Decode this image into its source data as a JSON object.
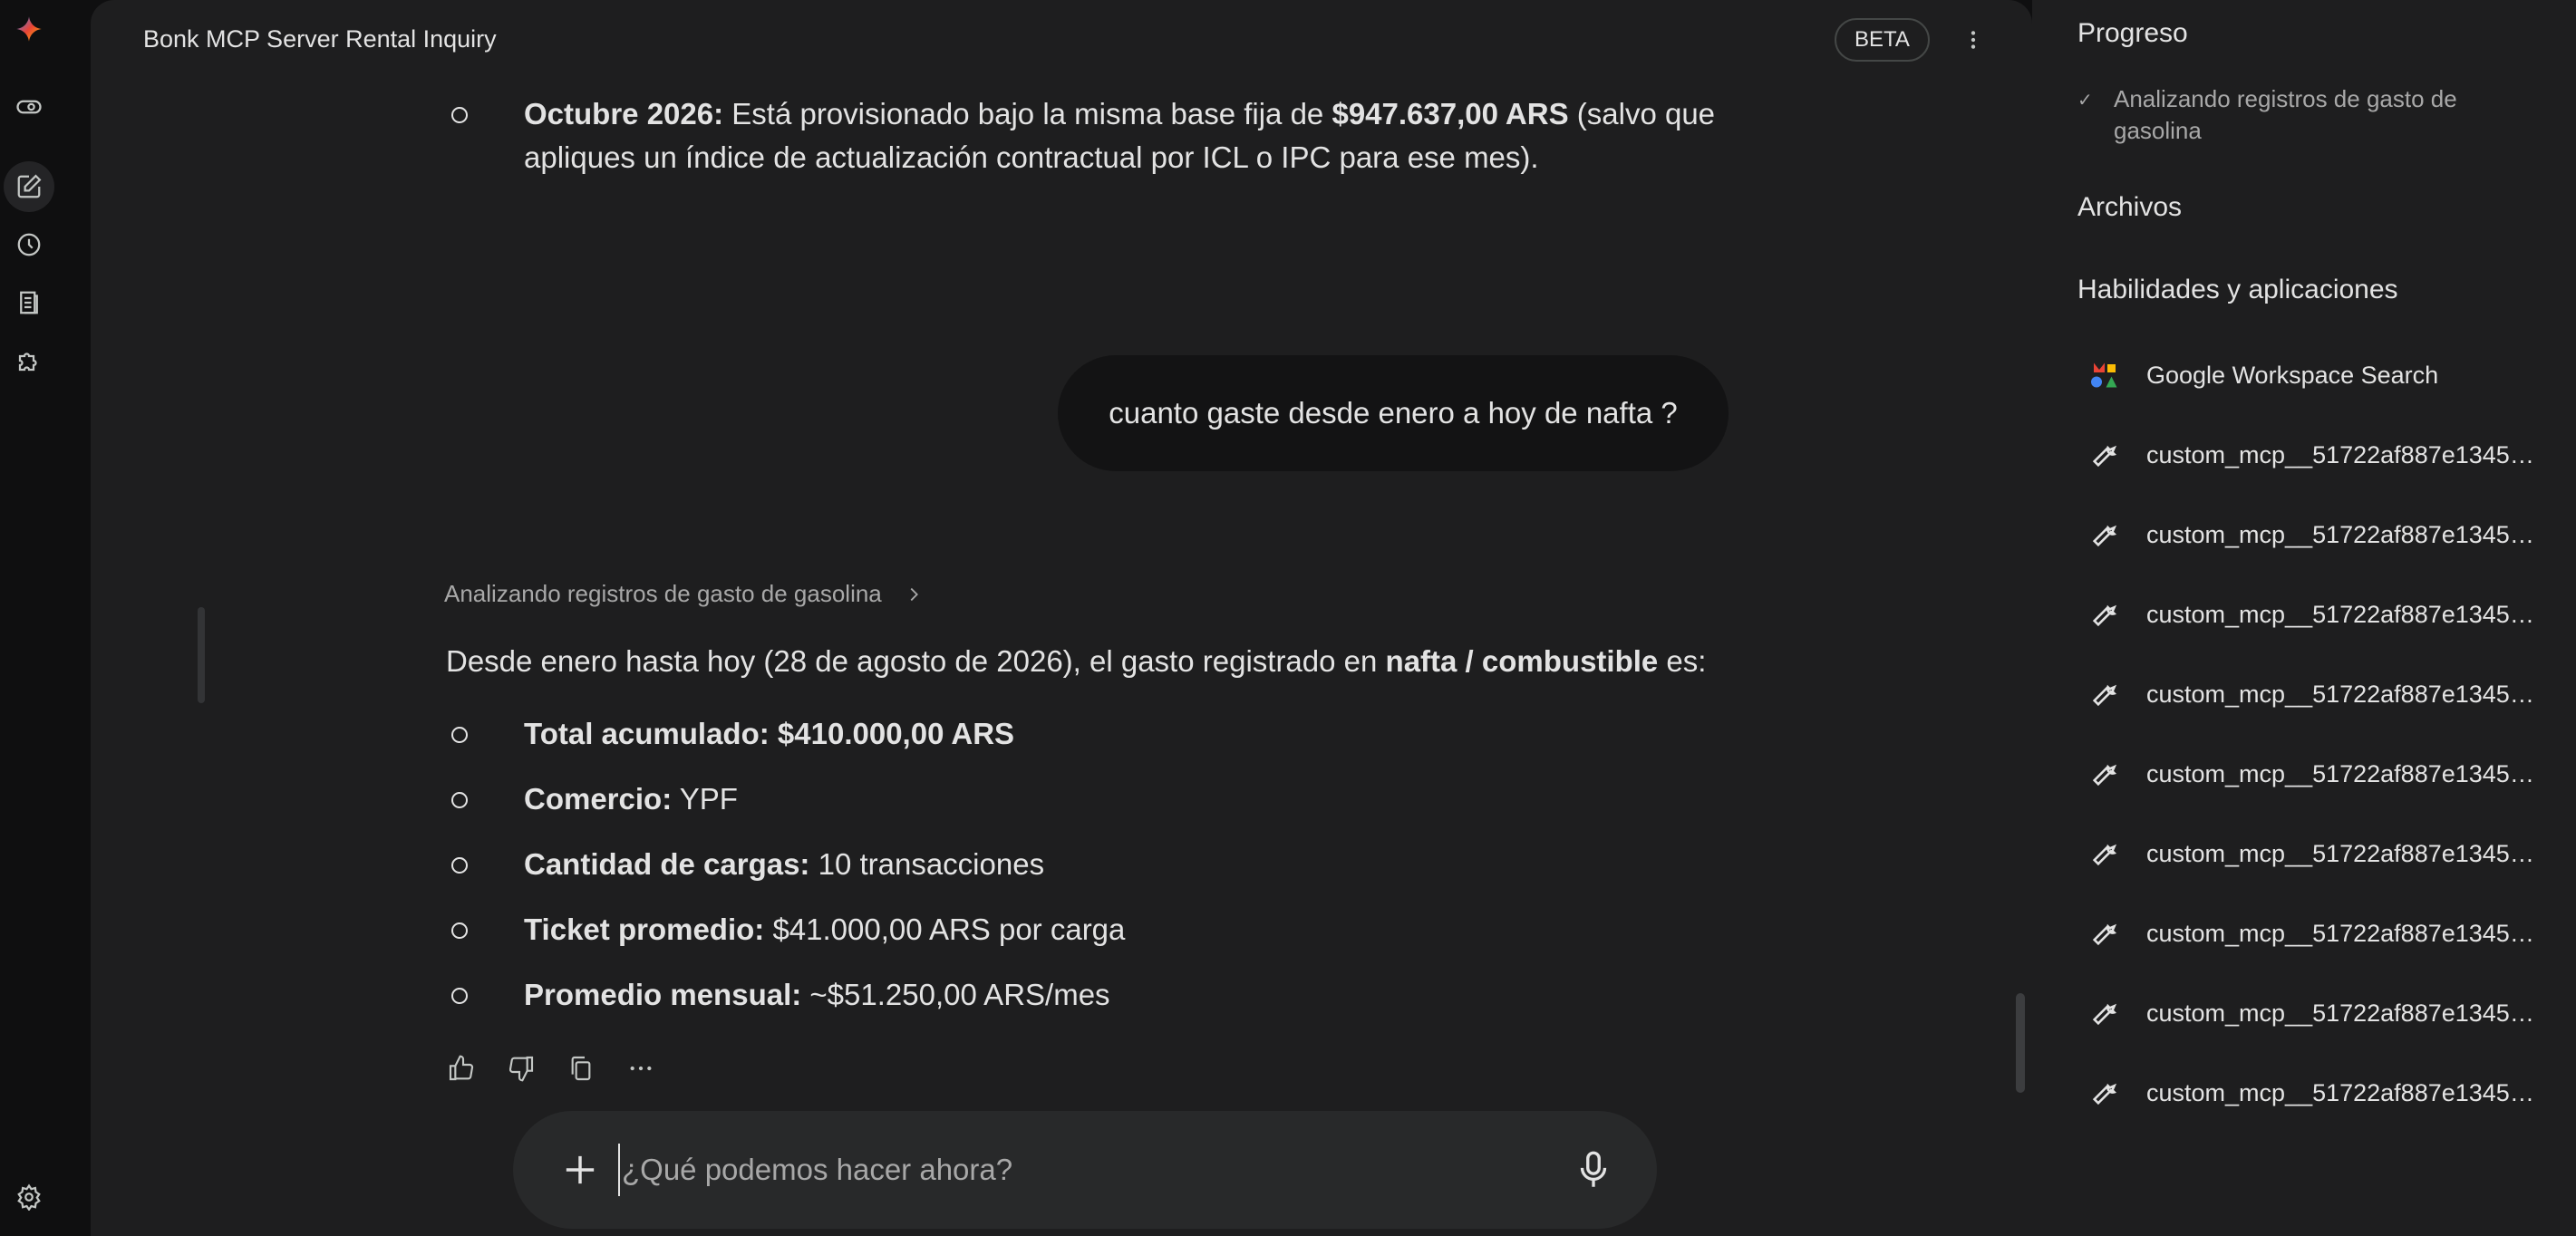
{
  "header": {
    "title": "Bonk MCP Server Rental Inquiry",
    "badge": "BETA"
  },
  "chat": {
    "prev_item": {
      "label": "Octubre 2026:",
      "text_a": " Está provisionado bajo la misma base fija de ",
      "amount": "$947.637,00 ARS",
      "text_b": " (salvo que",
      "line2": "apliques un índice de actualización contractual por ICL o IPC para ese mes)."
    },
    "user_message": "cuanto gaste desde enero a hoy de nafta ?",
    "thinking_label": "Analizando registros de gasto de gasolina",
    "intro": {
      "a": "Desde enero hasta hoy (28 de agosto de 2026), el gasto registrado en ",
      "b": "nafta / combustible",
      "c": " es:"
    },
    "items": [
      {
        "label": "Total acumulado:",
        "value": " $410.000,00 ARS"
      },
      {
        "label": "Comercio:",
        "value": " YPF"
      },
      {
        "label": "Cantidad de cargas:",
        "value": " 10 transacciones"
      },
      {
        "label": "Ticket promedio:",
        "value": " $41.000,00 ARS por carga"
      },
      {
        "label": "Promedio mensual:",
        "value": " ~$51.250,00 ARS/mes"
      }
    ]
  },
  "composer": {
    "placeholder": "¿Qué podemos hacer ahora?"
  },
  "side": {
    "progress_title": "Progreso",
    "progress_item": "Analizando registros de gasto de gasolina",
    "files_title": "Archivos",
    "skills_title": "Habilidades y aplicaciones",
    "apps": [
      "Google Workspace Search",
      "custom_mcp__51722af887e1345c0...",
      "custom_mcp__51722af887e1345c0...",
      "custom_mcp__51722af887e1345c0...",
      "custom_mcp__51722af887e1345c0...",
      "custom_mcp__51722af887e1345c0...",
      "custom_mcp__51722af887e1345c0...",
      "custom_mcp__51722af887e1345c0...",
      "custom_mcp__51722af887e1345c0...",
      "custom_mcp__51722af887e1345c0..."
    ]
  },
  "colors": {
    "panel": "#1e1e1f",
    "rail": "#0f0f10",
    "bubble": "#131314",
    "composer": "#28292a",
    "text": "#e3e3e3",
    "muted": "#a8a8a8"
  },
  "icons": {
    "rail": [
      "gemini-logo",
      "toggle-icon",
      "new-chat-icon",
      "history-icon",
      "library-icon",
      "puzzle-icon",
      "settings-icon"
    ],
    "actions": [
      "thumbs-up-icon",
      "thumbs-down-icon",
      "copy-icon",
      "more-icon"
    ]
  }
}
